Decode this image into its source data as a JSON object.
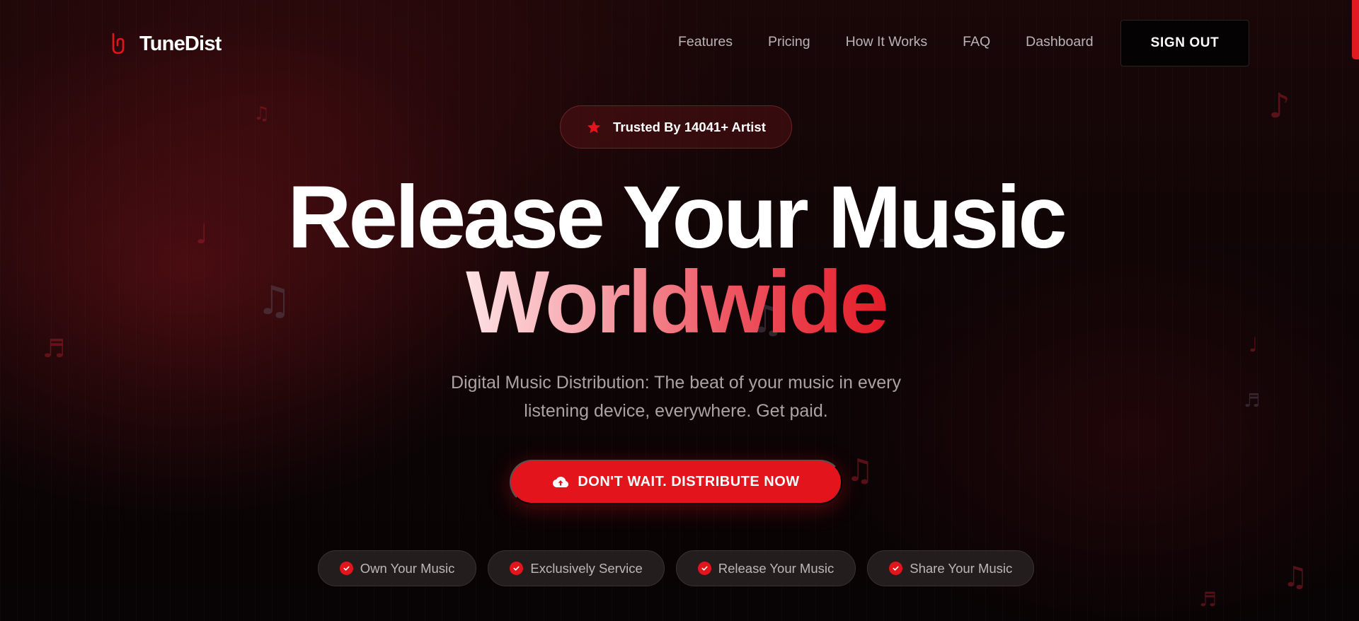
{
  "brand": {
    "name": "TuneDist",
    "logo_icon": "tunedist-logo-icon"
  },
  "nav": {
    "links": [
      "Features",
      "Pricing",
      "How It Works",
      "FAQ",
      "Dashboard"
    ],
    "signout_label": "SIGN OUT"
  },
  "hero": {
    "badge": {
      "icon": "star-icon",
      "text": "Trusted By 14041+ Artist"
    },
    "headline_line1": "Release Your Music",
    "headline_line2": "Worldwide",
    "subtitle_line1": "Digital Music Distribution: The beat of your music in every",
    "subtitle_line2": "listening device, everywhere. Get paid.",
    "cta": {
      "icon": "cloud-upload-icon",
      "label": "DON'T WAIT. DISTRIBUTE NOW"
    }
  },
  "features": [
    {
      "icon": "check-circle-icon",
      "label": "Own Your Music"
    },
    {
      "icon": "check-circle-icon",
      "label": "Exclusively Service"
    },
    {
      "icon": "check-circle-icon",
      "label": "Release Your Music"
    },
    {
      "icon": "check-circle-icon",
      "label": "Share Your Music"
    }
  ],
  "colors": {
    "accent": "#e3141c",
    "background": "#0b0506",
    "text_primary": "#ffffff",
    "text_muted": "#a9a3a4"
  }
}
